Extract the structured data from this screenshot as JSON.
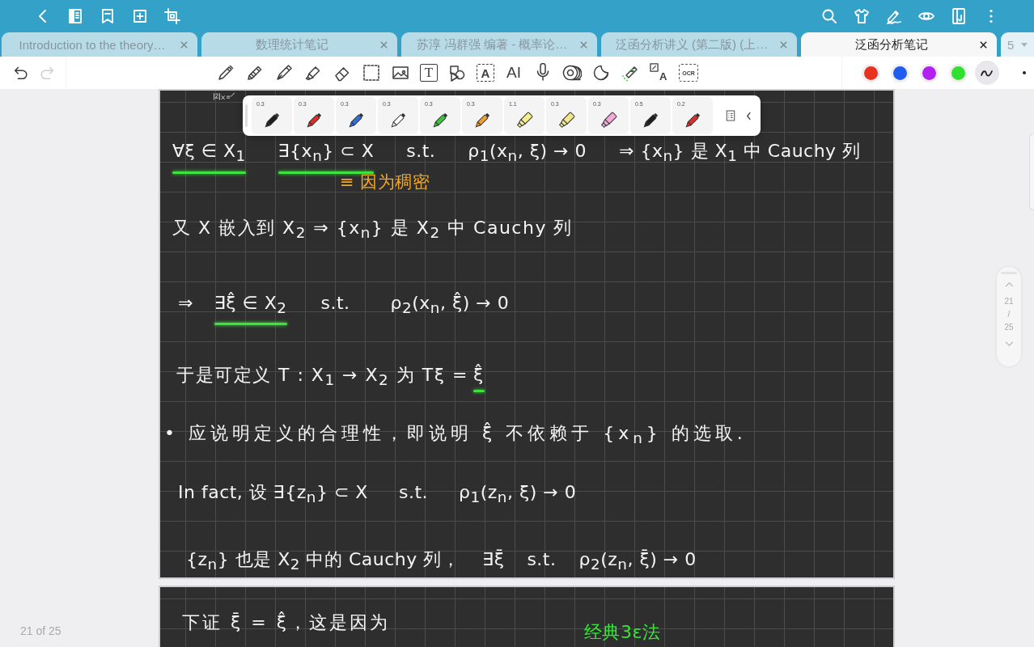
{
  "tabs": [
    {
      "title": "Introduction to the theory…",
      "selected": false
    },
    {
      "title": "数理统计笔记",
      "selected": false
    },
    {
      "title": "苏淳 冯群强 编著 - 概率论…",
      "selected": false
    },
    {
      "title": "泛函分析讲义 (第二版) (上…",
      "selected": false
    },
    {
      "title": "泛函分析笔记",
      "selected": true
    }
  ],
  "tab_count": "5",
  "history": {
    "undo_disabled": false,
    "redo_disabled": true
  },
  "tools": [
    {
      "kind": "pen"
    },
    {
      "kind": "pencil"
    },
    {
      "kind": "fountain"
    },
    {
      "kind": "highlighter"
    },
    {
      "kind": "eraser"
    },
    {
      "kind": "lasso"
    },
    {
      "kind": "image"
    },
    {
      "kind": "text",
      "label": "T"
    },
    {
      "kind": "shapes"
    },
    {
      "kind": "recognize",
      "label": "A"
    },
    {
      "kind": "ai",
      "label": "AI"
    },
    {
      "kind": "mic"
    },
    {
      "kind": "tape"
    },
    {
      "kind": "sticker"
    },
    {
      "kind": "laser"
    },
    {
      "kind": "translate",
      "label": "A"
    },
    {
      "kind": "ocr",
      "label": "OCR"
    }
  ],
  "palette": [
    {
      "color": "#e8321f"
    },
    {
      "color": "#1f5cf0"
    },
    {
      "color": "#b21ff0"
    },
    {
      "color": "#2fe02f"
    }
  ],
  "stroke_style": {
    "selected": true
  },
  "pen_popup": {
    "pens": [
      {
        "kind": "pen",
        "size": "0.3",
        "color": "#1e1e1e"
      },
      {
        "kind": "pen",
        "size": "0.3",
        "color": "#d9302c"
      },
      {
        "kind": "pen",
        "size": "0.3",
        "color": "#2f6fd6"
      },
      {
        "kind": "pen",
        "size": "0.3",
        "color": "#ffffff"
      },
      {
        "kind": "pen",
        "size": "0.3",
        "color": "#3cc43c"
      },
      {
        "kind": "pen",
        "size": "0.3",
        "color": "#f0a030"
      },
      {
        "kind": "highlighter",
        "size": "1.1",
        "color": "#f5ec8c"
      },
      {
        "kind": "highlighter",
        "size": "0.3",
        "color": "#f3e68a"
      },
      {
        "kind": "highlighter",
        "size": "0.3",
        "color": "#f2aad8"
      },
      {
        "kind": "pen",
        "size": "0.5",
        "color": "#1e1e1e"
      },
      {
        "kind": "pen",
        "size": "0.2",
        "color": "#d9302c"
      }
    ]
  },
  "pages": [
    {
      "lines": [
        {
          "segments": [
            {
              "text": "∀ξ ∈ X$_{1}$",
              "color": "#f4f4f4",
              "underlined": true
            },
            {
              "text": "∃{x$_{n}$} ⊂ X",
              "color": "#f4f4f4",
              "underlined": true
            },
            {
              "text": "s.t.",
              "color": "#f4f4f4",
              "underlined": false
            },
            {
              "text": "ρ$_{1}$(x$_{n}$, ξ) → 0",
              "color": "#f4f4f4",
              "underlined": false
            },
            {
              "text": "⇒ {x$_{n}$} 是 X$_{1}$ 中 Cauchy 列",
              "color": "#f4f4f4",
              "underlined": false
            }
          ]
        },
        {
          "segments": [
            {
              "text": "≡ 因为稠密",
              "color": "#f5a623",
              "underlined": false
            }
          ]
        },
        {
          "segments": [
            {
              "text": "又 X 嵌入到 X$_{2}$ ⇒ {x$_{n}$} 是 X$_{2}$ 中 Cauchy 列",
              "color": "#f4f4f4",
              "underlined": false
            }
          ]
        },
        {
          "segments": [
            {
              "text": "⇒",
              "color": "#f4f4f4",
              "underlined": false
            },
            {
              "text": "∃ξ̂ ∈ X$_{2}$",
              "color": "#f4f4f4",
              "underlined": true
            },
            {
              "text": "s.t.",
              "color": "#f4f4f4",
              "underlined": false
            },
            {
              "text": "ρ$_{2}$(x$_{n}$, ξ̂) → 0",
              "color": "#f4f4f4",
              "underlined": false
            }
          ]
        },
        {
          "segments": [
            {
              "text": "于是可定义 T : X$_{1}$ → X$_{2}$ 为 Tξ =",
              "color": "#f4f4f4",
              "underlined": false
            },
            {
              "text": "ξ̂",
              "color": "#f4f4f4",
              "underlined": true
            }
          ]
        },
        {
          "segments": [
            {
              "text": "• 应说明定义的合理性，即说明 ξ̂ 不依赖于 {x$_{n}$} 的选取.",
              "color": "#f4f4f4",
              "underlined": false
            }
          ]
        },
        {
          "segments": [
            {
              "text": "In fact, 设 ∃{z$_{n}$} ⊂ X",
              "color": "#f4f4f4",
              "underlined": false
            },
            {
              "text": "s.t.",
              "color": "#f4f4f4",
              "underlined": false
            },
            {
              "text": "ρ$_{1}$(z$_{n}$, ξ) → 0",
              "color": "#f4f4f4",
              "underlined": false
            }
          ]
        },
        {
          "segments": [
            {
              "text": "{z$_{n}$} 也是 X$_{2}$ 中的 Cauchy 列，",
              "color": "#f4f4f4",
              "underlined": false
            },
            {
              "text": "∃ξ̄",
              "color": "#f4f4f4",
              "underlined": false
            },
            {
              "text": "s.t.",
              "color": "#f4f4f4",
              "underlined": false
            },
            {
              "text": "ρ$_{2}$(z$_{n}$, ξ̄) → 0",
              "color": "#f4f4f4",
              "underlined": false
            }
          ]
        }
      ]
    },
    {
      "lines": [
        {
          "segments": [
            {
              "text": "下证 ξ̄ = ξ̂，这是因为",
              "color": "#f4f4f4",
              "underlined": false
            },
            {
              "text": "经典3ε法",
              "color": "#37e637",
              "underlined": false
            }
          ]
        }
      ]
    }
  ],
  "page_indicator": {
    "current": "21",
    "separator": "/",
    "total": "25"
  },
  "page_counter": "21 of 25"
}
